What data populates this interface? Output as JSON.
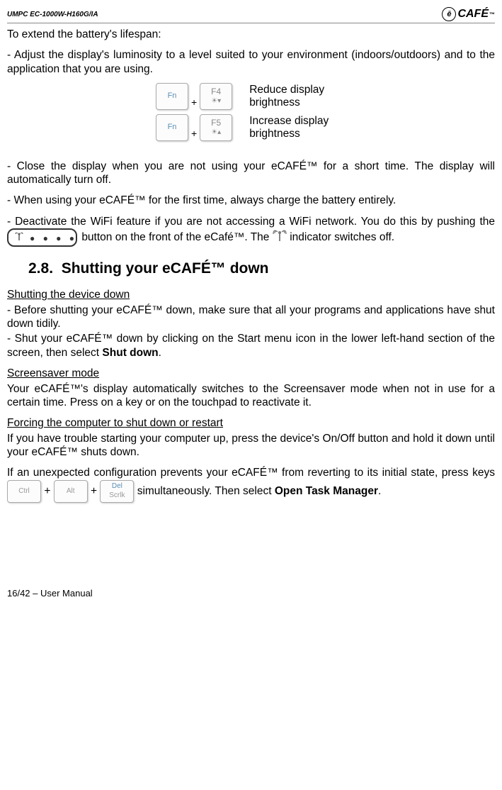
{
  "header": {
    "model": "UMPC EC-1000W-H160G/IA",
    "brand_text": "CAFÉ",
    "brand_tm": "™"
  },
  "intro": {
    "lifespan": "To extend the battery's lifespan:",
    "adjust": "- Adjust the display's luminosity to a level suited to your environment (indoors/outdoors) and to the application that you are using."
  },
  "keys": {
    "fn_label": "Fn",
    "f4_label": "F4",
    "f5_label": "F5",
    "reduce_line1": "Reduce display",
    "reduce_line2": "brightness",
    "increase_line1": "Increase display",
    "increase_line2": "brightness"
  },
  "bullets": {
    "close_display": "- Close the display when you are not using your eCAFÉ™ for a short time. The display will automatically turn off.",
    "first_time": "- When using your eCAFÉ™ for the first time, always charge the battery entirely.",
    "deactivate_pre": "- Deactivate the WiFi feature if you are not accessing a WiFi network. You do this by pushing the",
    "deactivate_mid": " button on the front of the eCafé™. The ",
    "deactivate_post": " indicator switches off."
  },
  "section": {
    "number": "2.8.",
    "title": "Shutting your eCAFÉ™ down"
  },
  "shutdown": {
    "heading": "Shutting the device down",
    "line1": "- Before shutting your eCAFÉ™ down, make sure that all your programs and applications have shut down tidily.",
    "line2_pre": "- Shut your eCAFÉ™ down by clicking on the Start menu icon in the lower left-hand section of the screen, then select ",
    "line2_bold": "Shut down",
    "line2_post": "."
  },
  "screensaver": {
    "heading": "Screensaver mode",
    "text": "Your eCAFÉ™'s display automatically switches to the Screensaver mode when not in use for a certain time. Press on a key or on the touchpad to reactivate it."
  },
  "forcing": {
    "heading": "Forcing the computer to shut down or restart",
    "text1": "If you have trouble starting your computer up, press the device's On/Off button and hold it down until your eCAFÉ™ shuts down.",
    "text2_pre": "If an unexpected configuration prevents your eCAFÉ™ from reverting to its initial state, press keys",
    "ctrl": "Ctrl",
    "alt": "Alt",
    "del_line1": "Del",
    "del_line2": "Scrlk",
    "plus": "+",
    "text2_mid": " simultaneously. Then select ",
    "text2_bold": "Open Task Manager",
    "text2_post": "."
  },
  "footer": {
    "text": "16/42 – User Manual"
  }
}
